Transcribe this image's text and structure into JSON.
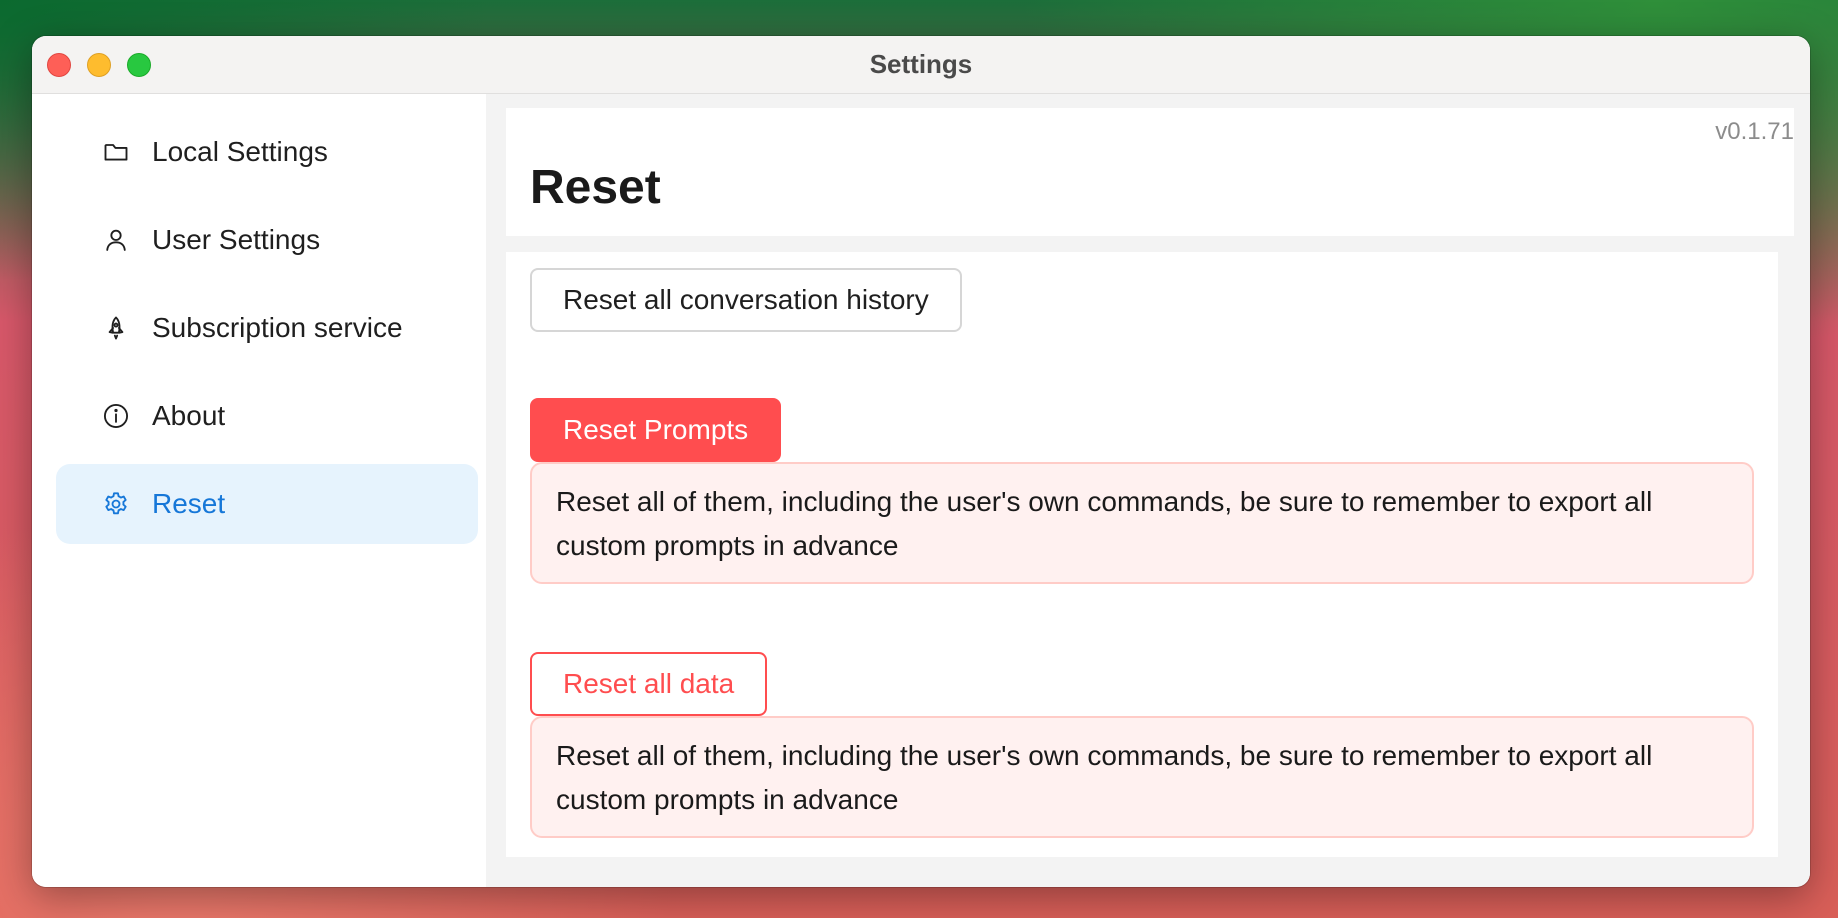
{
  "window": {
    "title": "Settings"
  },
  "sidebar": {
    "items": [
      {
        "label": "Local Settings",
        "icon": "folder-icon",
        "active": false
      },
      {
        "label": "User Settings",
        "icon": "user-icon",
        "active": false
      },
      {
        "label": "Subscription service",
        "icon": "rocket-icon",
        "active": false
      },
      {
        "label": "About",
        "icon": "info-icon",
        "active": false
      },
      {
        "label": "Reset",
        "icon": "gear-icon",
        "active": true
      }
    ]
  },
  "main": {
    "version": "v0.1.71",
    "title": "Reset",
    "reset_history_label": "Reset all conversation history",
    "reset_prompts_label": "Reset Prompts",
    "reset_prompts_warning": "Reset all of them, including the user's own commands, be sure to remember to export all custom prompts in advance",
    "reset_all_data_label": "Reset all data",
    "reset_all_data_warning": "Reset all of them, including the user's own commands, be sure to remember to export all custom prompts in advance"
  },
  "colors": {
    "accent": "#1677d8",
    "active_bg": "#e6f3fd",
    "danger": "#ff4d4f",
    "danger_bg": "#fff1f0",
    "danger_border": "#ffccc7"
  }
}
